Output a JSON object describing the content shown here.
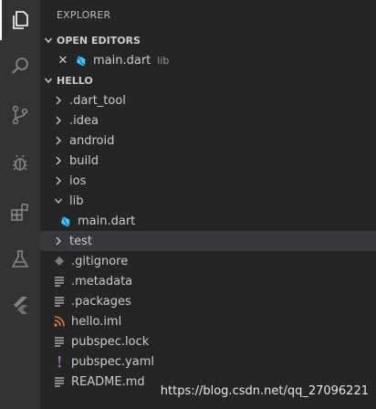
{
  "explorer": {
    "title": "EXPLORER"
  },
  "open_editors": {
    "header": "OPEN EDITORS",
    "items": [
      {
        "name": "main.dart",
        "folder": "lib"
      }
    ]
  },
  "workspace": {
    "header": "HELLO",
    "tree": [
      {
        "label": ".dart_tool",
        "kind": "folder",
        "expanded": false
      },
      {
        "label": ".idea",
        "kind": "folder",
        "expanded": false
      },
      {
        "label": "android",
        "kind": "folder",
        "expanded": false
      },
      {
        "label": "build",
        "kind": "folder",
        "expanded": false
      },
      {
        "label": "ios",
        "kind": "folder",
        "expanded": false
      },
      {
        "label": "lib",
        "kind": "folder",
        "expanded": true
      },
      {
        "label": "main.dart",
        "kind": "dart-file"
      },
      {
        "label": "test",
        "kind": "folder",
        "expanded": false,
        "selected": true
      },
      {
        "label": ".gitignore",
        "kind": "git-file"
      },
      {
        "label": ".metadata",
        "kind": "text-file"
      },
      {
        "label": ".packages",
        "kind": "text-file"
      },
      {
        "label": "hello.iml",
        "kind": "rss-file"
      },
      {
        "label": "pubspec.lock",
        "kind": "text-file"
      },
      {
        "label": "pubspec.yaml",
        "kind": "yaml-file"
      },
      {
        "label": "README.md",
        "kind": "text-file"
      }
    ]
  },
  "watermark": "https://blog.csdn.net/qq_27096221",
  "colors": {
    "activity_bar": "#333333",
    "sidebar": "#252526",
    "selection": "#37373d",
    "dart_blue": "#40c4ff",
    "rss_orange": "#e37933",
    "yaml_purple": "#a074c4"
  },
  "activity_icons": [
    "files-icon",
    "search-icon",
    "source-control-icon",
    "debug-icon",
    "extensions-icon",
    "testing-icon",
    "flutter-icon"
  ]
}
